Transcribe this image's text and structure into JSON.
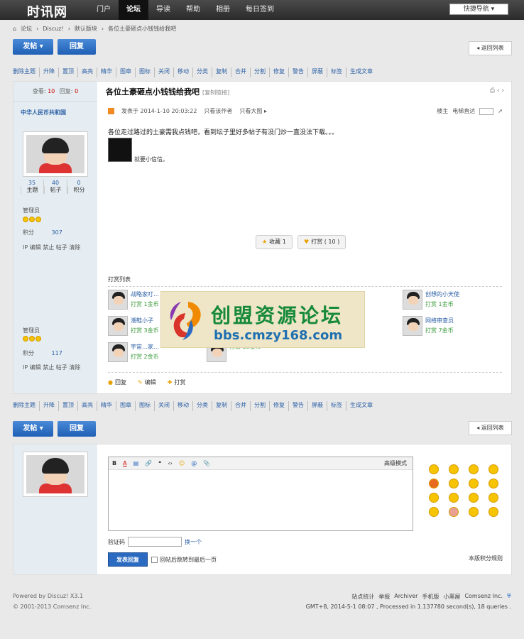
{
  "site": {
    "logo": "时讯网",
    "quick_nav": "快捷导航 ▾"
  },
  "nav": [
    "门户",
    "论坛",
    "导读",
    "帮助",
    "相册",
    "每日签到"
  ],
  "breadcrumb": [
    "⌂",
    "论坛",
    "›",
    "Discuz!",
    "›",
    "默认版块",
    "›",
    "各位土豪砸点小钱钱给我吧"
  ],
  "buttons": {
    "post": "发帖 ▾",
    "reply": "回复",
    "back": "◂ 返回列表"
  },
  "mod_actions": [
    "删除主题",
    "升降",
    "置顶",
    "高亮",
    "精华",
    "图章",
    "图标",
    "关闭",
    "移动",
    "分类",
    "复制",
    "合并",
    "分割",
    "修复",
    "警告",
    "屏蔽",
    "标签",
    "生成文章"
  ],
  "thread": {
    "views_label": "查看:",
    "views": "10",
    "replies_label": "回复:",
    "replies": "0",
    "title": "各位土豪砸点小钱钱给我吧",
    "title_tag": "[复制链接]",
    "author": "中华人民币共和国",
    "stats": [
      {
        "n": "35",
        "l": "主题"
      },
      {
        "n": "40",
        "l": "帖子"
      },
      {
        "n": "0",
        "l": "积分"
      }
    ],
    "group": "管理员",
    "credit_label": "积分",
    "credit": "307",
    "admin_links": "IP 编辑 禁止 帖子 清除",
    "posted": "发表于 2014-1-10 20:03:22",
    "only_author": "只看该作者",
    "only_big": "只看大图 ▸",
    "landlord": "楼主",
    "jump": "电梯直达",
    "content": "各位走过路过的土豪需我点钱吧，看到坛子里好多帖子有没门炒一直没法下载。。。",
    "sign": "就要小信信。",
    "fav": "收藏 1",
    "reward": "打赏 ( 10 )",
    "reward_list_title": "打赏列表",
    "rewards": [
      {
        "name": "战略家叮…",
        "amt": "打赏 1金币"
      },
      {
        "name": "潮鞋小子",
        "amt": "打赏 3金币"
      },
      {
        "name": "宇宙…家…",
        "amt": "打赏 2金币"
      },
      {
        "name": "",
        "amt": "打赏 13金币"
      },
      {
        "name": "创想的小天使",
        "amt": "打赏 1金币"
      },
      {
        "name": "网络审查员",
        "amt": "打赏 7金币"
      }
    ],
    "actions": [
      {
        "i": "●",
        "t": "回复"
      },
      {
        "i": "✎",
        "t": "编辑"
      },
      {
        "i": "✚",
        "t": "打赏"
      }
    ],
    "side2_group": "管理员",
    "side2_credit": "117"
  },
  "watermark": {
    "cn": "创盟资源论坛",
    "url": "bbs.cmzy168.com"
  },
  "reply_box": {
    "toolbar": [
      "B",
      "A",
      "▤",
      "🔗",
      "❝",
      "‹›",
      "☺",
      "@",
      "",
      "📎"
    ],
    "advanced": "高级模式",
    "verify_label": "验证码",
    "verify_link": "换一个",
    "submit": "发表回复",
    "check_label": "回帖后跳转到最后一页",
    "rules": "本版积分规则"
  },
  "footer": {
    "powered": "Powered by Discuz! X3.1",
    "copy": "© 2001-2013 Comsenz Inc.",
    "links": [
      "站点统计",
      "举报",
      "Archiver",
      "手机版",
      "小黑屋",
      "Comsenz Inc."
    ],
    "gmt": "GMT+8, 2014-5-1 08:07 , Processed in 1.137780 second(s), 18 queries ."
  }
}
